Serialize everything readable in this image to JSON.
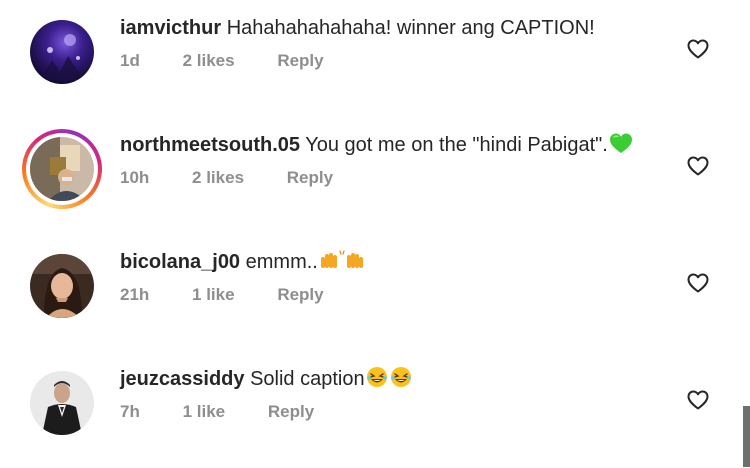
{
  "comments": [
    {
      "username": "iamvicthur",
      "text": "Hahahahahahaha! winner ang CAPTION!",
      "time": "1d",
      "likes": "2 likes",
      "reply": "Reply"
    },
    {
      "username": "northmeetsouth.05",
      "text": "You got me on the \"hindi Pabigat\".",
      "time": "10h",
      "likes": "2 likes",
      "reply": "Reply",
      "emoji": "green-heart-emoji"
    },
    {
      "username": "bicolana_j00",
      "text": "emmm..",
      "time": "21h",
      "likes": "1 like",
      "reply": "Reply",
      "emoji": "raising-hands-emoji"
    },
    {
      "username": "jeuzcassiddy",
      "text": "Solid caption",
      "time": "7h",
      "likes": "1 like",
      "reply": "Reply",
      "emoji": "laughing-emoji"
    }
  ],
  "icons": {
    "like": "heart-outline-icon"
  },
  "colors": {
    "text": "#262626",
    "meta": "#8e8e8e",
    "green_heart": "#3ccc34",
    "emoji_yellow": "#f5a623"
  }
}
